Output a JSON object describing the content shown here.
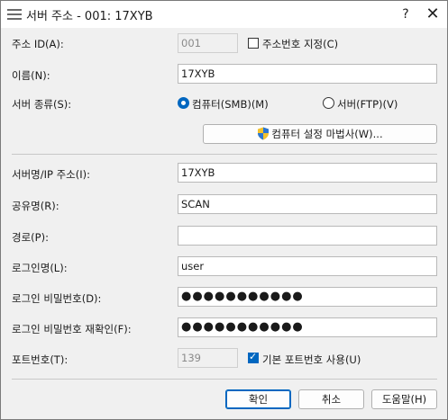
{
  "window": {
    "title": "서버 주소 - 001: 17XYB",
    "help_glyph": "?",
    "close_glyph": "✕"
  },
  "address_id": {
    "label": "주소 ID(A):",
    "value": "001"
  },
  "specify_address_number": {
    "label": "주소번호 지정(C)",
    "checked": false
  },
  "name": {
    "label": "이름(N):",
    "value": "17XYB"
  },
  "server_type": {
    "label": "서버 종류(S):",
    "options": [
      {
        "label": "컴퓨터(SMB)(M)",
        "selected": true
      },
      {
        "label": "서버(FTP)(V)",
        "selected": false
      }
    ]
  },
  "wizard_button": {
    "label": "컴퓨터 설정 마법사(W)...",
    "icon": "uac-shield-icon"
  },
  "server_name": {
    "label": "서버명/IP 주소(I):",
    "value": "17XYB"
  },
  "share_name": {
    "label": "공유명(R):",
    "value": "SCAN"
  },
  "path": {
    "label": "경로(P):",
    "value": ""
  },
  "login_name": {
    "label": "로그인명(L):",
    "value": "user"
  },
  "login_password": {
    "label": "로그인 비밀번호(D):",
    "value": "●●●●●●●●●●●"
  },
  "confirm_password": {
    "label": "로그인 비밀번호 재확인(F):",
    "value": "●●●●●●●●●●●"
  },
  "port": {
    "label": "포트번호(T):",
    "value": "139"
  },
  "use_default_port": {
    "label": "기본 포트번호 사용(U)",
    "checked": true
  },
  "buttons": {
    "ok": "확인",
    "cancel": "취소",
    "help": "도움말(H)"
  },
  "colors": {
    "accent": "#0067c0",
    "dialog_bg": "#f0f0f0"
  }
}
